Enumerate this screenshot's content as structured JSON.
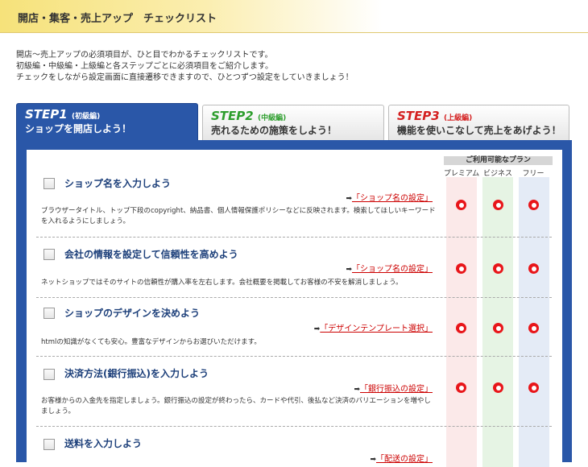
{
  "header": {
    "title": "開店・集客・売上アップ　チェックリスト"
  },
  "intro": {
    "lines": [
      "開店～売上アップの必須項目が、ひと目でわかるチェックリストです。",
      "初級編・中級編・上級編と各ステップごとに必須項目をご紹介します。",
      "チェックをしながら設定画面に直接遷移できますので、ひとつずつ設定をしていきましょう！"
    ]
  },
  "tabs": [
    {
      "step": "STEP1",
      "level": "(初級編)",
      "text": "ショップを開店しよう！",
      "color": "#2a57a8"
    },
    {
      "step": "STEP2",
      "level": "(中級編)",
      "text": "売れるための施策をしよう！",
      "color": "#2d9e2d"
    },
    {
      "step": "STEP3",
      "level": "(上級編)",
      "text": "機能を使いこなして売上をあげよう！",
      "color": "#d42020"
    }
  ],
  "plans": {
    "caption": "ご利用可能なプラン",
    "names": [
      "プレミアム",
      "ビジネス",
      "フリー"
    ],
    "colors": [
      "#fbe9e9",
      "#e6f4e4",
      "#e4ebf6"
    ]
  },
  "items": [
    {
      "title": "ショップ名を入力しよう",
      "link": "「ショップ名の設定」",
      "desc": "ブラウザータイトル、トップ下段のcopyright、納品書、個人情報保護ポリシーなどに反映されます。検索してほしいキーワードを入れるようにしましょう。",
      "available": [
        true,
        true,
        true
      ]
    },
    {
      "title": "会社の情報を設定して信頼性を高めよう",
      "link": "「ショップ名の設定」",
      "desc": "ネットショップではそのサイトの信頼性が購入率を左右します。会社概要を掲載してお客様の不安を解消しましょう。",
      "available": [
        true,
        true,
        true
      ]
    },
    {
      "title": "ショップのデザインを決めよう",
      "link": "「デザインテンプレート選択」",
      "desc": "htmlの知識がなくても安心。豊富なデザインからお選びいただけます。",
      "available": [
        true,
        true,
        true
      ]
    },
    {
      "title": "決済方法(銀行振込)を入力しよう",
      "link": "「銀行振込の設定」",
      "desc": "お客様からの入金先を指定しましょう。銀行振込の設定が終わったら、カードや代引、後払など決済のバリエーションを増やしましょう。",
      "available": [
        true,
        true,
        true
      ]
    },
    {
      "title": "送料を入力しよう",
      "link": "「配送の設定」",
      "desc": "",
      "available": [
        true,
        true,
        true
      ]
    }
  ]
}
